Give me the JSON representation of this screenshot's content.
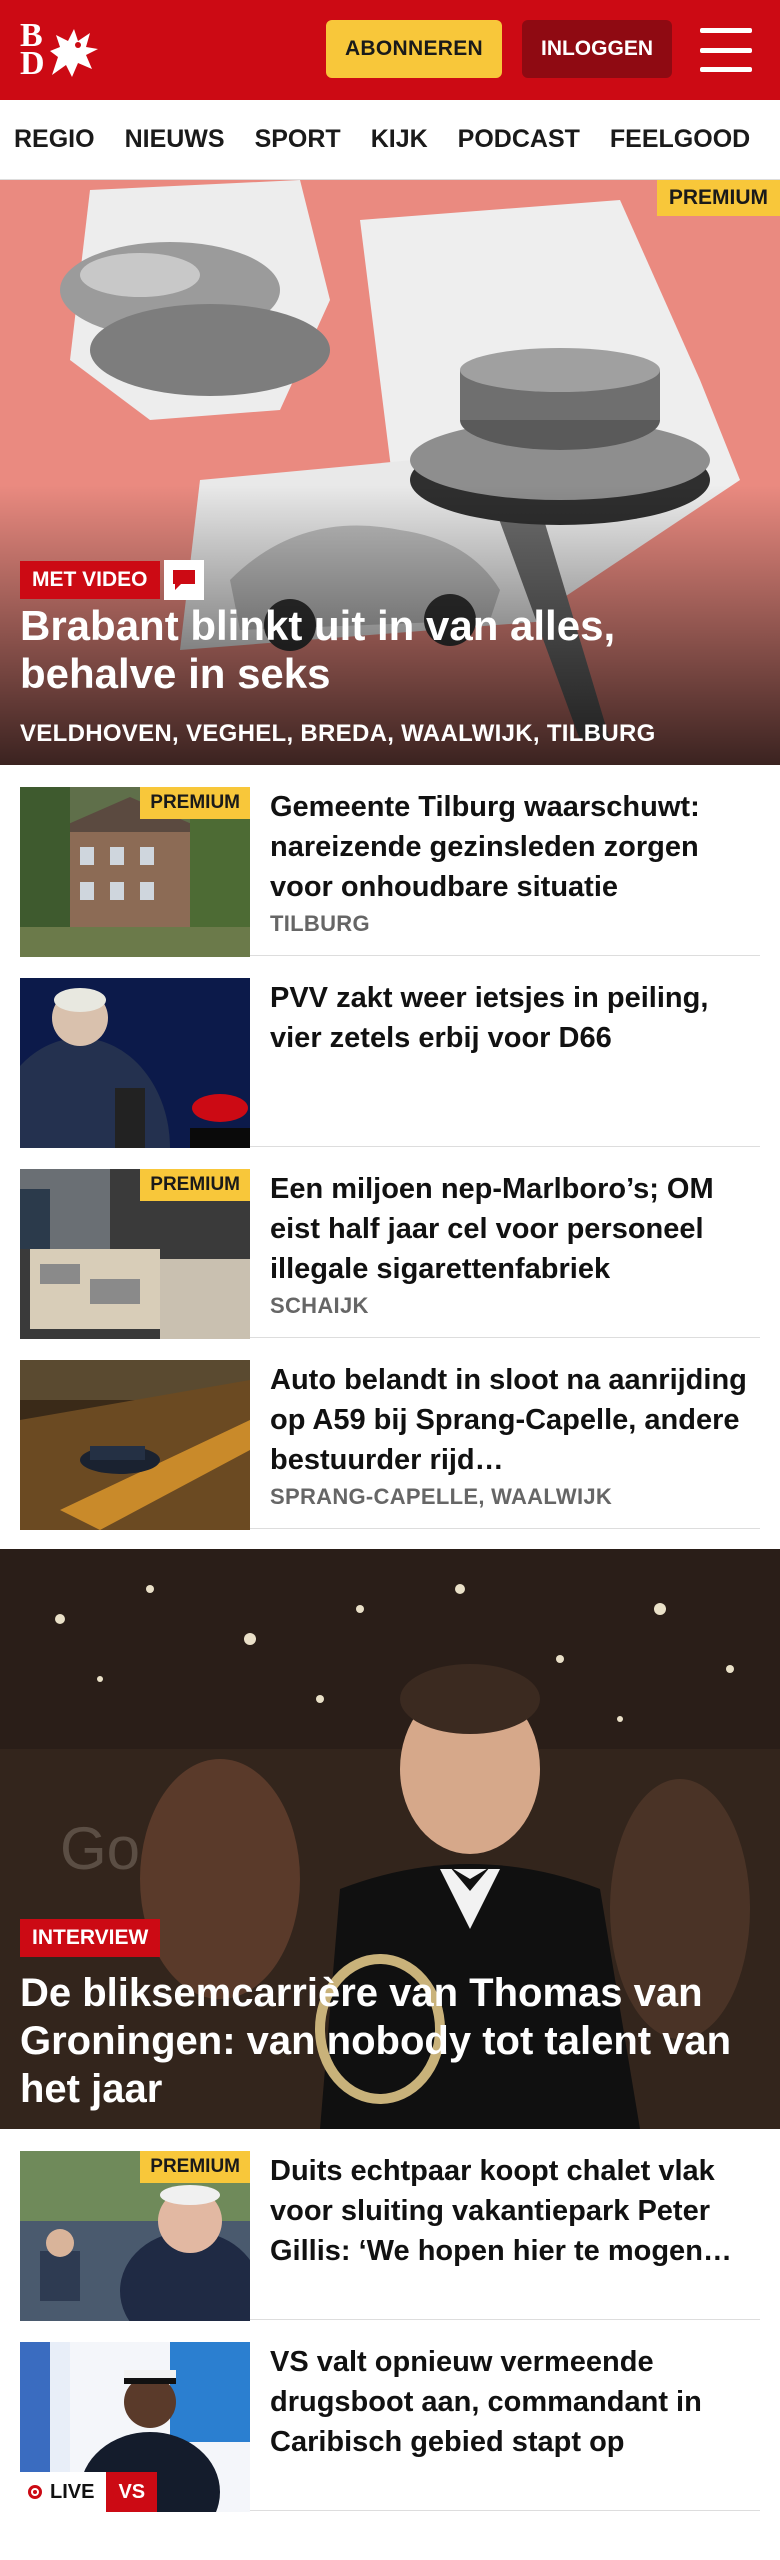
{
  "header": {
    "logo_text": "BD",
    "subscribe_label": "ABONNEREN",
    "login_label": "INLOGGEN",
    "colors": {
      "brand": "#cc0a14",
      "subscribe": "#f8c73a",
      "login": "#8f0a12"
    }
  },
  "nav": {
    "items": [
      "REGIO",
      "NIEUWS",
      "SPORT",
      "KIJK",
      "PODCAST",
      "FEELGOOD"
    ]
  },
  "hero": {
    "premium": "PREMIUM",
    "label": "MET VIDEO",
    "title": "Brabant blinkt uit in van alles, behalve in seks",
    "locations": "VELDHOVEN, VEGHEL, BREDA, WAALWIJK, TILBURG"
  },
  "articles": [
    {
      "premium": "PREMIUM",
      "title": "Gemeente Tilburg waarschuwt: nareizende gezinsleden zorgen voor onhoudbare situatie",
      "location": "TILBURG"
    },
    {
      "title": "PVV zakt weer ietsjes in peiling, vier zetels erbij voor D66"
    },
    {
      "premium": "PREMIUM",
      "title": "Een miljoen nep-Marlboro’s; OM eist half jaar cel voor personeel illegale sigarettenfabriek",
      "location": "SCHAIJK"
    },
    {
      "title": "Auto belandt in sloot na aanrijding op A59 bij Sprang-Capelle, andere bestuurder rijd…",
      "location": "SPRANG-CAPELLE, WAALWIJK"
    }
  ],
  "feature": {
    "label": "INTERVIEW",
    "title": "De bliksemcarrière van Thomas van Groningen: van nobody tot talent van het jaar"
  },
  "articles2": [
    {
      "premium": "PREMIUM",
      "title": "Duits echtpaar koopt chalet vlak voor sluiting vakantiepark Peter Gillis: ‘We hopen hier te mogen…"
    },
    {
      "title": "VS valt opnieuw vermeende drugsboot aan, commandant in Caribisch gebied stapt op",
      "live": "LIVE",
      "live_tag": "VS"
    }
  ]
}
